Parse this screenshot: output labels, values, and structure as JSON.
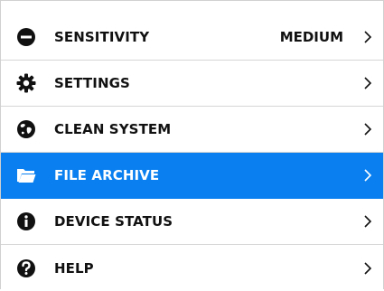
{
  "menu": {
    "items": [
      {
        "label": "SENSITIVITY",
        "value": "MEDIUM",
        "icon": "minus-circle-icon",
        "selected": false
      },
      {
        "label": "SETTINGS",
        "icon": "gear-icon",
        "selected": false
      },
      {
        "label": "CLEAN SYSTEM",
        "icon": "globe-icon",
        "selected": false
      },
      {
        "label": "FILE ARCHIVE",
        "icon": "folder-open-icon",
        "selected": true
      },
      {
        "label": "DEVICE STATUS",
        "icon": "info-icon",
        "selected": false
      },
      {
        "label": "HELP",
        "icon": "help-icon",
        "selected": false
      }
    ]
  },
  "colors": {
    "highlight": "#0a80f0",
    "text": "#111111",
    "separator": "#d6d6d6"
  }
}
